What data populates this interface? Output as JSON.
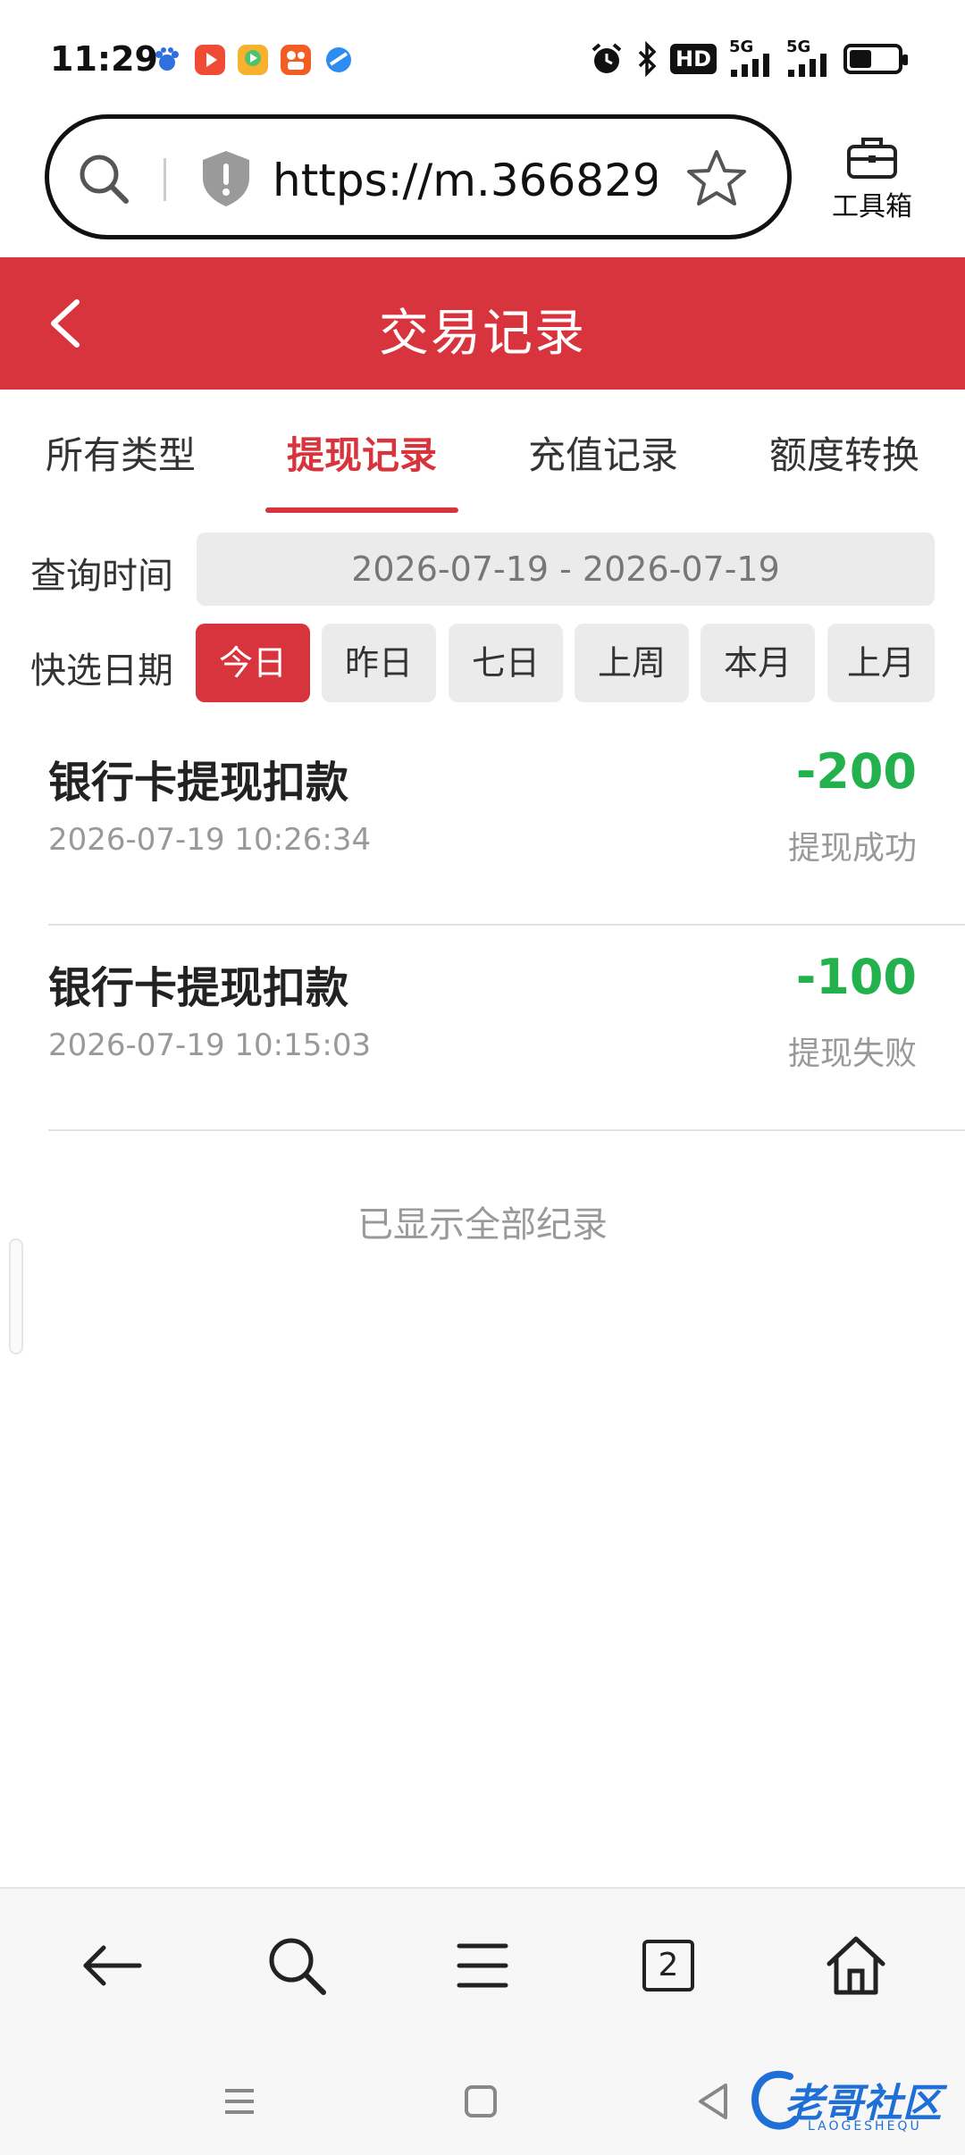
{
  "status_bar": {
    "time": "11:29",
    "network_hd": "HD",
    "network_5g_1": "5G",
    "network_5g_2": "5G"
  },
  "browser": {
    "url": "https://m.366829....",
    "toolbox_label": "工具箱"
  },
  "header": {
    "title": "交易记录"
  },
  "tabs": [
    {
      "label": "所有类型",
      "active": false
    },
    {
      "label": "提现记录",
      "active": true
    },
    {
      "label": "充值记录",
      "active": false
    },
    {
      "label": "额度转换",
      "active": false
    }
  ],
  "query": {
    "time_label": "查询时间",
    "date_range": "2026-07-19 - 2026-07-19",
    "quick_label": "快选日期",
    "quick_options": [
      "今日",
      "昨日",
      "七日",
      "上周",
      "本月",
      "上月"
    ],
    "quick_selected": "今日"
  },
  "records": [
    {
      "title": "银行卡提现扣款",
      "time": "2026-07-19 10:26:34",
      "amount": "-200",
      "status": "提现成功"
    },
    {
      "title": "银行卡提现扣款",
      "time": "2026-07-19 10:15:03",
      "amount": "-100",
      "status": "提现失败"
    }
  ],
  "footer_text": "已显示全部纪录",
  "bottom_nav": {
    "tab_count": "2"
  },
  "watermark": {
    "text": "老哥社区",
    "sub": "LAOGESHEQU"
  },
  "colors": {
    "accent": "#d8343d",
    "amount_green": "#22b14c"
  }
}
